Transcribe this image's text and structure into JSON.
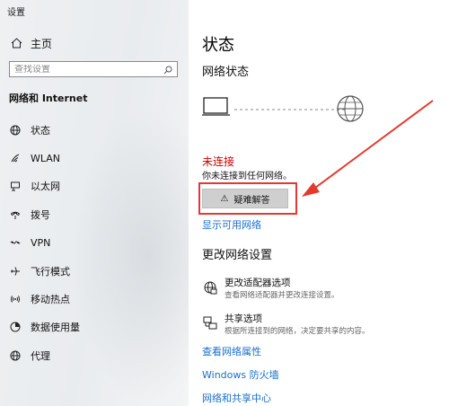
{
  "window": {
    "title": "设置"
  },
  "sidebar": {
    "home_label": "主页",
    "search_placeholder": "查找设置",
    "section_heading": "网络和 Internet",
    "items": [
      {
        "label": "状态",
        "icon": "status-globe-icon",
        "active": true
      },
      {
        "label": "WLAN",
        "icon": "wifi-icon"
      },
      {
        "label": "以太网",
        "icon": "ethernet-icon"
      },
      {
        "label": "拨号",
        "icon": "dialup-phone-icon"
      },
      {
        "label": "VPN",
        "icon": "vpn-icon"
      },
      {
        "label": "飞行模式",
        "icon": "airplane-icon"
      },
      {
        "label": "移动热点",
        "icon": "hotspot-icon"
      },
      {
        "label": "数据使用量",
        "icon": "data-usage-icon"
      },
      {
        "label": "代理",
        "icon": "proxy-globe-icon"
      }
    ]
  },
  "main": {
    "title": "状态",
    "network_status_heading": "网络状态",
    "connection_state": "未连接",
    "connection_desc": "你未连接到任何网络。",
    "troubleshoot_label": "疑难解答",
    "show_networks_link": "显示可用网络",
    "change_settings_heading": "更改网络设置",
    "options": [
      {
        "title": "更改适配器选项",
        "desc": "查看网络适配器并更改连接设置。",
        "icon": "adapter-icon"
      },
      {
        "title": "共享选项",
        "desc": "根据所连接到的网络，决定要共享的内容。",
        "icon": "sharing-icon"
      }
    ],
    "links": [
      "查看网络属性",
      "Windows 防火墙",
      "网络和共享中心"
    ]
  },
  "colors": {
    "accent_link": "#1a6fc9",
    "error_text": "#c60000",
    "annotation_red": "#e23a2e"
  }
}
